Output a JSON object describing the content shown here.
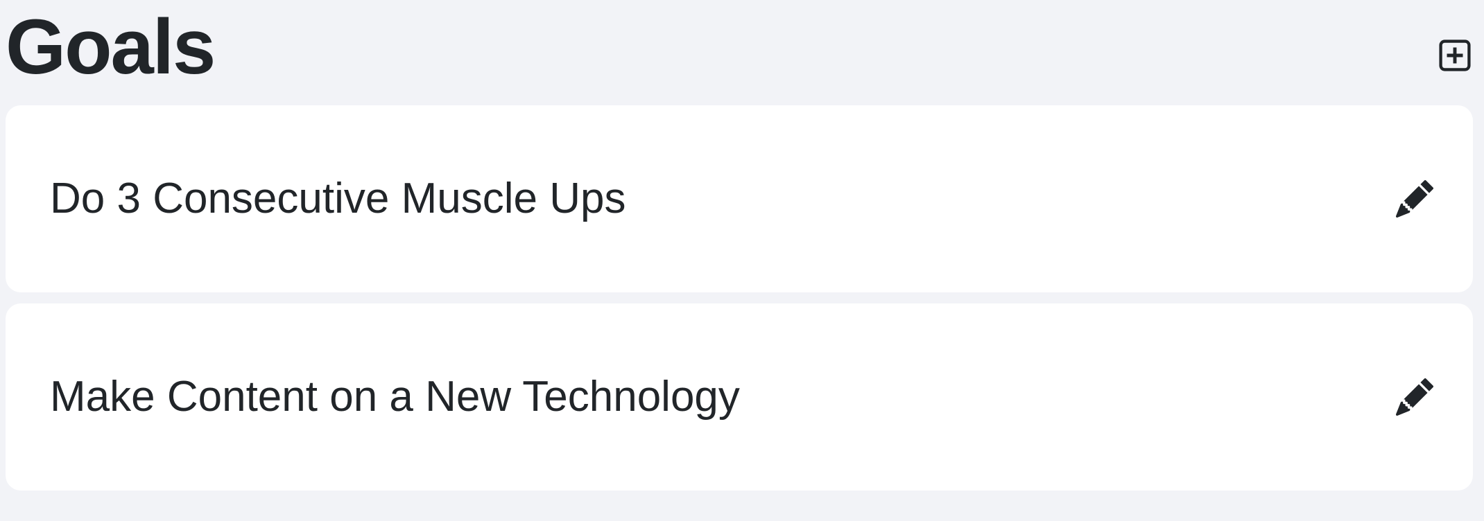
{
  "header": {
    "title": "Goals",
    "add_icon": "plus-square-icon"
  },
  "goals": [
    {
      "title": "Do 3 Consecutive Muscle Ups",
      "edit_icon": "pencil-icon"
    },
    {
      "title": "Make Content on a New Technology",
      "edit_icon": "pencil-icon"
    }
  ],
  "colors": {
    "background": "#f2f3f7",
    "card": "#ffffff",
    "text": "#212529"
  }
}
